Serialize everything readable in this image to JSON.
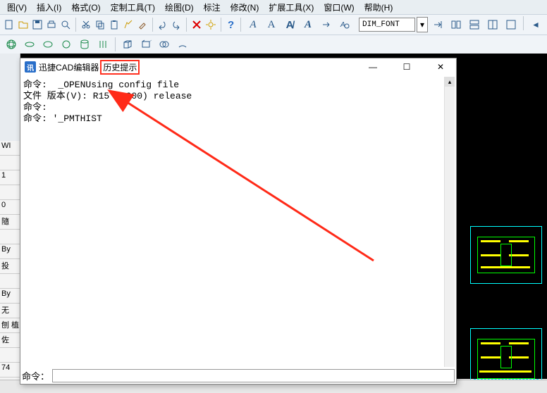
{
  "menu": {
    "items": [
      "图(V)",
      "插入(I)",
      "格式(O)",
      "定制工具(T)",
      "绘图(D)",
      "标注",
      "修改(N)",
      "扩展工具(X)",
      "窗口(W)",
      "帮助(H)"
    ]
  },
  "toolbar1": {
    "font_label": "A",
    "dim_font_value": "DIM_FONT"
  },
  "toolbar2_icons": [
    "globe",
    "ellipse",
    "ellipse2",
    "oval",
    "cylinder",
    "bars",
    "box",
    "box2",
    "rings",
    "arc"
  ],
  "history_window": {
    "title_app": "迅捷CAD编辑器",
    "title_suffix": "历史提示",
    "minimize": "—",
    "maximize": "☐",
    "close": "✕",
    "content": "命令:  _OPENUsing config file\n文件 版本(V): R15 (2000) release\n命令:\n命令: '_PMTHIST",
    "prompt_label": "命令：",
    "prompt_value": ""
  },
  "side_labels": [
    "WI",
    "",
    "1",
    "",
    "0",
    "隨",
    "",
    "By",
    "投",
    "",
    "By",
    "无",
    "刨 植",
    "佐",
    "",
    "74",
    ""
  ]
}
